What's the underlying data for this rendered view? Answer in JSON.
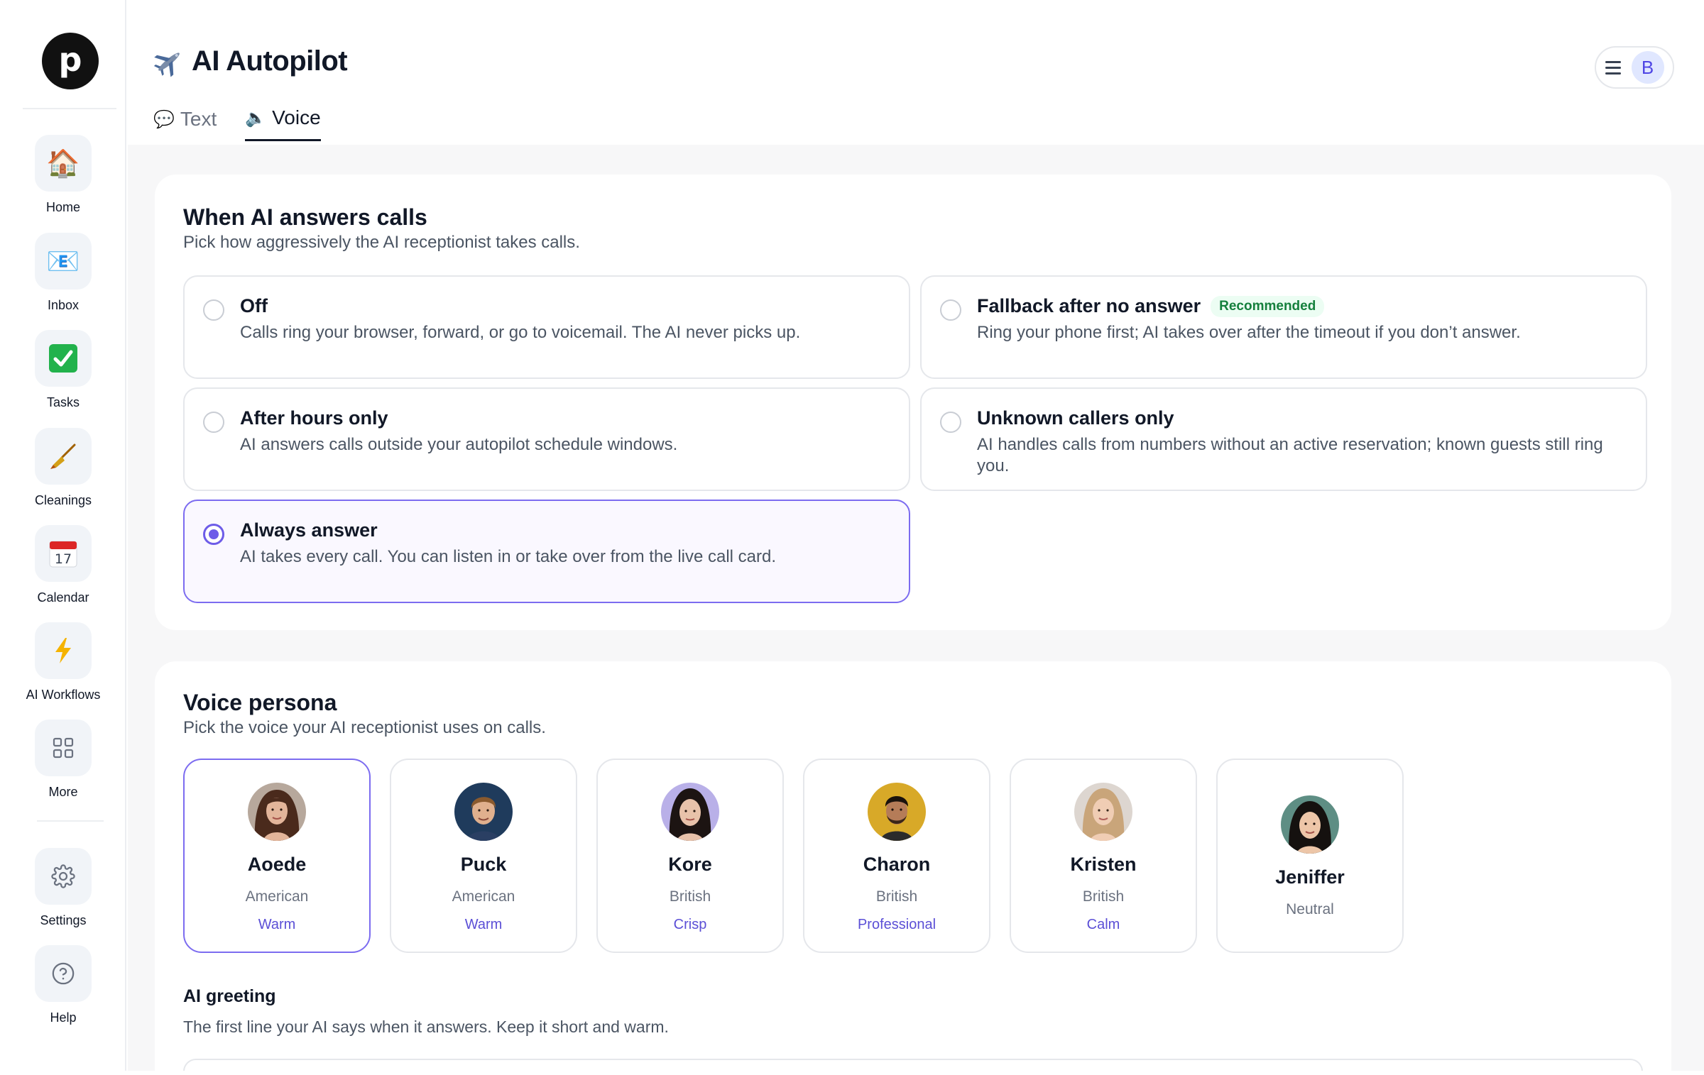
{
  "brand": {
    "logo_letter": "p"
  },
  "sidebar": {
    "items": [
      {
        "label": "Home",
        "icon": "house-icon",
        "glyph": "🏠"
      },
      {
        "label": "Inbox",
        "icon": "mail-icon",
        "glyph": "📧"
      },
      {
        "label": "Tasks",
        "icon": "check-icon",
        "glyph": "✅"
      },
      {
        "label": "Cleanings",
        "icon": "broom-icon",
        "glyph": "🧹"
      },
      {
        "label": "Calendar",
        "icon": "calendar-icon",
        "glyph": "📅"
      },
      {
        "label": "AI Workflows",
        "icon": "lightning-icon",
        "glyph": "⚡"
      },
      {
        "label": "More",
        "icon": "grid-icon",
        "glyph": ""
      }
    ],
    "bottom_items": [
      {
        "label": "Settings",
        "icon": "gear-icon"
      },
      {
        "label": "Help",
        "icon": "help-icon"
      }
    ]
  },
  "header": {
    "title": "AI Autopilot",
    "title_icon": "airplane-icon",
    "avatar_initial": "B"
  },
  "tabs": [
    {
      "label": "Text",
      "icon": "speech-bubble-icon",
      "glyph": "💬",
      "active": false
    },
    {
      "label": "Voice",
      "icon": "speaker-icon",
      "glyph": "🔈",
      "active": true
    }
  ],
  "answer_calls": {
    "title": "When AI answers calls",
    "subtitle": "Pick how aggressively the AI receptionist takes calls.",
    "options": [
      {
        "title": "Off",
        "desc": "Calls ring your browser, forward, or go to voicemail. The AI never picks up.",
        "selected": false
      },
      {
        "title": "Fallback after no answer",
        "badge": "Recommended",
        "desc": "Ring your phone first; AI takes over after the timeout if you don’t answer.",
        "selected": false
      },
      {
        "title": "After hours only",
        "desc": "AI answers calls outside your autopilot schedule windows.",
        "selected": false
      },
      {
        "title": "Unknown callers only",
        "desc": "AI handles calls from numbers without an active reservation; known guests still ring you.",
        "selected": false
      },
      {
        "title": "Always answer",
        "desc": "AI takes every call. You can listen in or take over from the live call card.",
        "selected": true
      }
    ]
  },
  "voice_persona": {
    "title": "Voice persona",
    "subtitle": "Pick the voice your AI receptionist uses on calls.",
    "personas": [
      {
        "name": "Aoede",
        "accent": "American",
        "tone": "Warm",
        "selected": true
      },
      {
        "name": "Puck",
        "accent": "American",
        "tone": "Warm",
        "selected": false
      },
      {
        "name": "Kore",
        "accent": "British",
        "tone": "Crisp",
        "selected": false
      },
      {
        "name": "Charon",
        "accent": "British",
        "tone": "Professional",
        "selected": false
      },
      {
        "name": "Kristen",
        "accent": "British",
        "tone": "Calm",
        "selected": false
      },
      {
        "name": "Jeniffer",
        "accent": "Neutral",
        "tone": "",
        "selected": false
      }
    ],
    "greeting": {
      "title": "AI greeting",
      "subtitle": "The first line your AI says when it answers. Keep it short and warm."
    }
  },
  "colors": {
    "accent": "#6d5ce8",
    "selected_border": "#7c6cf0",
    "recommended_text": "#15803d",
    "main_bg": "#f7f7f8"
  }
}
